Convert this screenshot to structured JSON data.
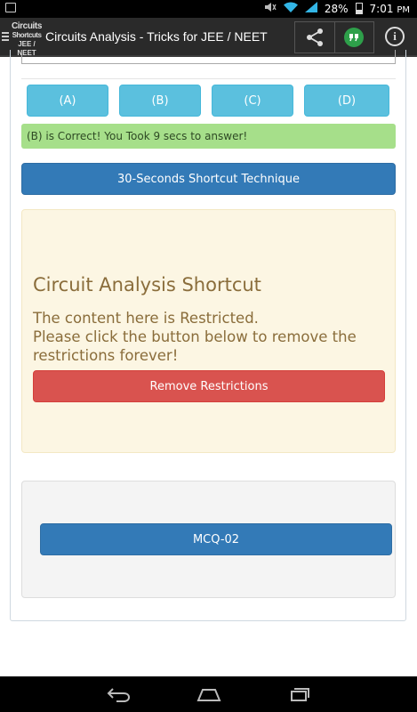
{
  "status_bar": {
    "battery_text": "28%",
    "time": "7:01",
    "time_suffix": "PM"
  },
  "action_bar": {
    "logo_line1": "Circuits",
    "logo_line2": "Shortcuts",
    "logo_line3": "JEE / NEET",
    "title": "Circuits Analysis - Tricks for JEE / NEET"
  },
  "options": {
    "a": "(A)",
    "b": "(B)",
    "c": "(C)",
    "d": "(D)"
  },
  "result_message": "(B) is Correct! You Took 9 secs to answer!",
  "shortcut_button": "30-Seconds Shortcut Technique",
  "restricted_panel": {
    "title": "Circuit Analysis Shortcut",
    "line1": "The content here is Restricted.",
    "line2": "Please click the button below to remove the restrictions forever!",
    "button": "Remove Restrictions"
  },
  "next_panel": {
    "button": "MCQ-02"
  },
  "colors": {
    "info": "#5bc0de",
    "success_bg": "#a6df8a",
    "primary": "#337ab7",
    "warning_bg": "#fcf6e3",
    "warning_text": "#8a6d3b",
    "danger": "#d9534f"
  },
  "icons": {
    "status_left": "image-icon",
    "mute": "mute-icon",
    "wifi": "wifi-icon",
    "signal": "signal-icon",
    "battery": "battery-icon",
    "menu": "drawer-menu-icon",
    "share": "share-icon",
    "hangouts": "hangouts-icon",
    "info": "info-icon",
    "back": "back-icon",
    "home": "home-icon",
    "recents": "recent-apps-icon"
  }
}
